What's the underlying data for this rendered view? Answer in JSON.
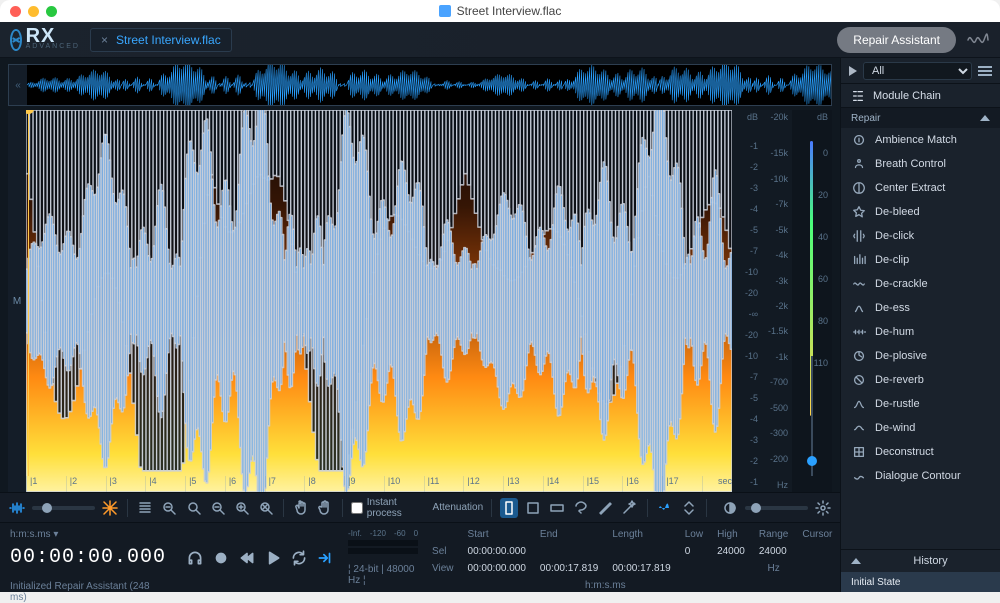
{
  "window": {
    "title": "Street Interview.flac"
  },
  "header": {
    "logo": "RX",
    "logo_sub": "ADVANCED",
    "tab_label": "Street Interview.flac",
    "repair_button": "Repair Assistant"
  },
  "spectro": {
    "channel_label": "M",
    "time_ticks": [
      "|1",
      "|2",
      "|3",
      "|4",
      "|5",
      "|6",
      "|7",
      "|8",
      "|9",
      "|10",
      "|11",
      "|12",
      "|13",
      "|14",
      "|15",
      "|16",
      "|17"
    ],
    "time_unit": "sec",
    "db_axis": {
      "label_top": "dB",
      "ticks": [
        "-1",
        "-2",
        "-3",
        "-4",
        "-5",
        "-7",
        "-10",
        "-20",
        "-∞",
        "-20",
        "-10",
        "-7",
        "-5",
        "-4",
        "-3",
        "-2",
        "-1"
      ]
    },
    "freq_axis": {
      "label_top": "-20k",
      "ticks": [
        "-15k",
        "-10k",
        "-7k",
        "-5k",
        "-4k",
        "-3k",
        "-2k",
        "-1.5k",
        "-1k",
        "-700",
        "-500",
        "-300",
        "-200"
      ],
      "label_bot": "Hz"
    },
    "meter_axis": {
      "label_top": "dB",
      "ticks": [
        "0",
        "20",
        "40",
        "60",
        "80",
        "110"
      ]
    }
  },
  "toolbar": {
    "instant_process": "Instant process",
    "attenuation": "Attenuation"
  },
  "status": {
    "time_label": "h:m:s.ms",
    "timecode": "00:00:00.000",
    "message": "Initialized Repair Assistant (248 ms)",
    "format": "24-bit | 48000 Hz",
    "level_scale": [
      "-Inf.",
      "-120",
      "-60",
      "0"
    ],
    "table": {
      "headers": [
        "Start",
        "End",
        "Length"
      ],
      "sel": [
        "00:00:00.000",
        "",
        ""
      ],
      "view": [
        "00:00:00.000",
        "00:00:17.819",
        "00:00:17.819"
      ],
      "row_sel": "Sel",
      "row_view": "View",
      "unit": "h:m:s.ms"
    },
    "freq": {
      "headers": [
        "Low",
        "High",
        "Range",
        "Cursor"
      ],
      "values": [
        "0",
        "24000",
        "24000",
        ""
      ],
      "unit": "Hz"
    }
  },
  "sidebar": {
    "filter": "All",
    "chain": "Module Chain",
    "category": "Repair",
    "modules": [
      "Ambience Match",
      "Breath Control",
      "Center Extract",
      "De-bleed",
      "De-click",
      "De-clip",
      "De-crackle",
      "De-ess",
      "De-hum",
      "De-plosive",
      "De-reverb",
      "De-rustle",
      "De-wind",
      "Deconstruct",
      "Dialogue Contour"
    ],
    "history_label": "History",
    "history_items": [
      "Initial State"
    ]
  }
}
